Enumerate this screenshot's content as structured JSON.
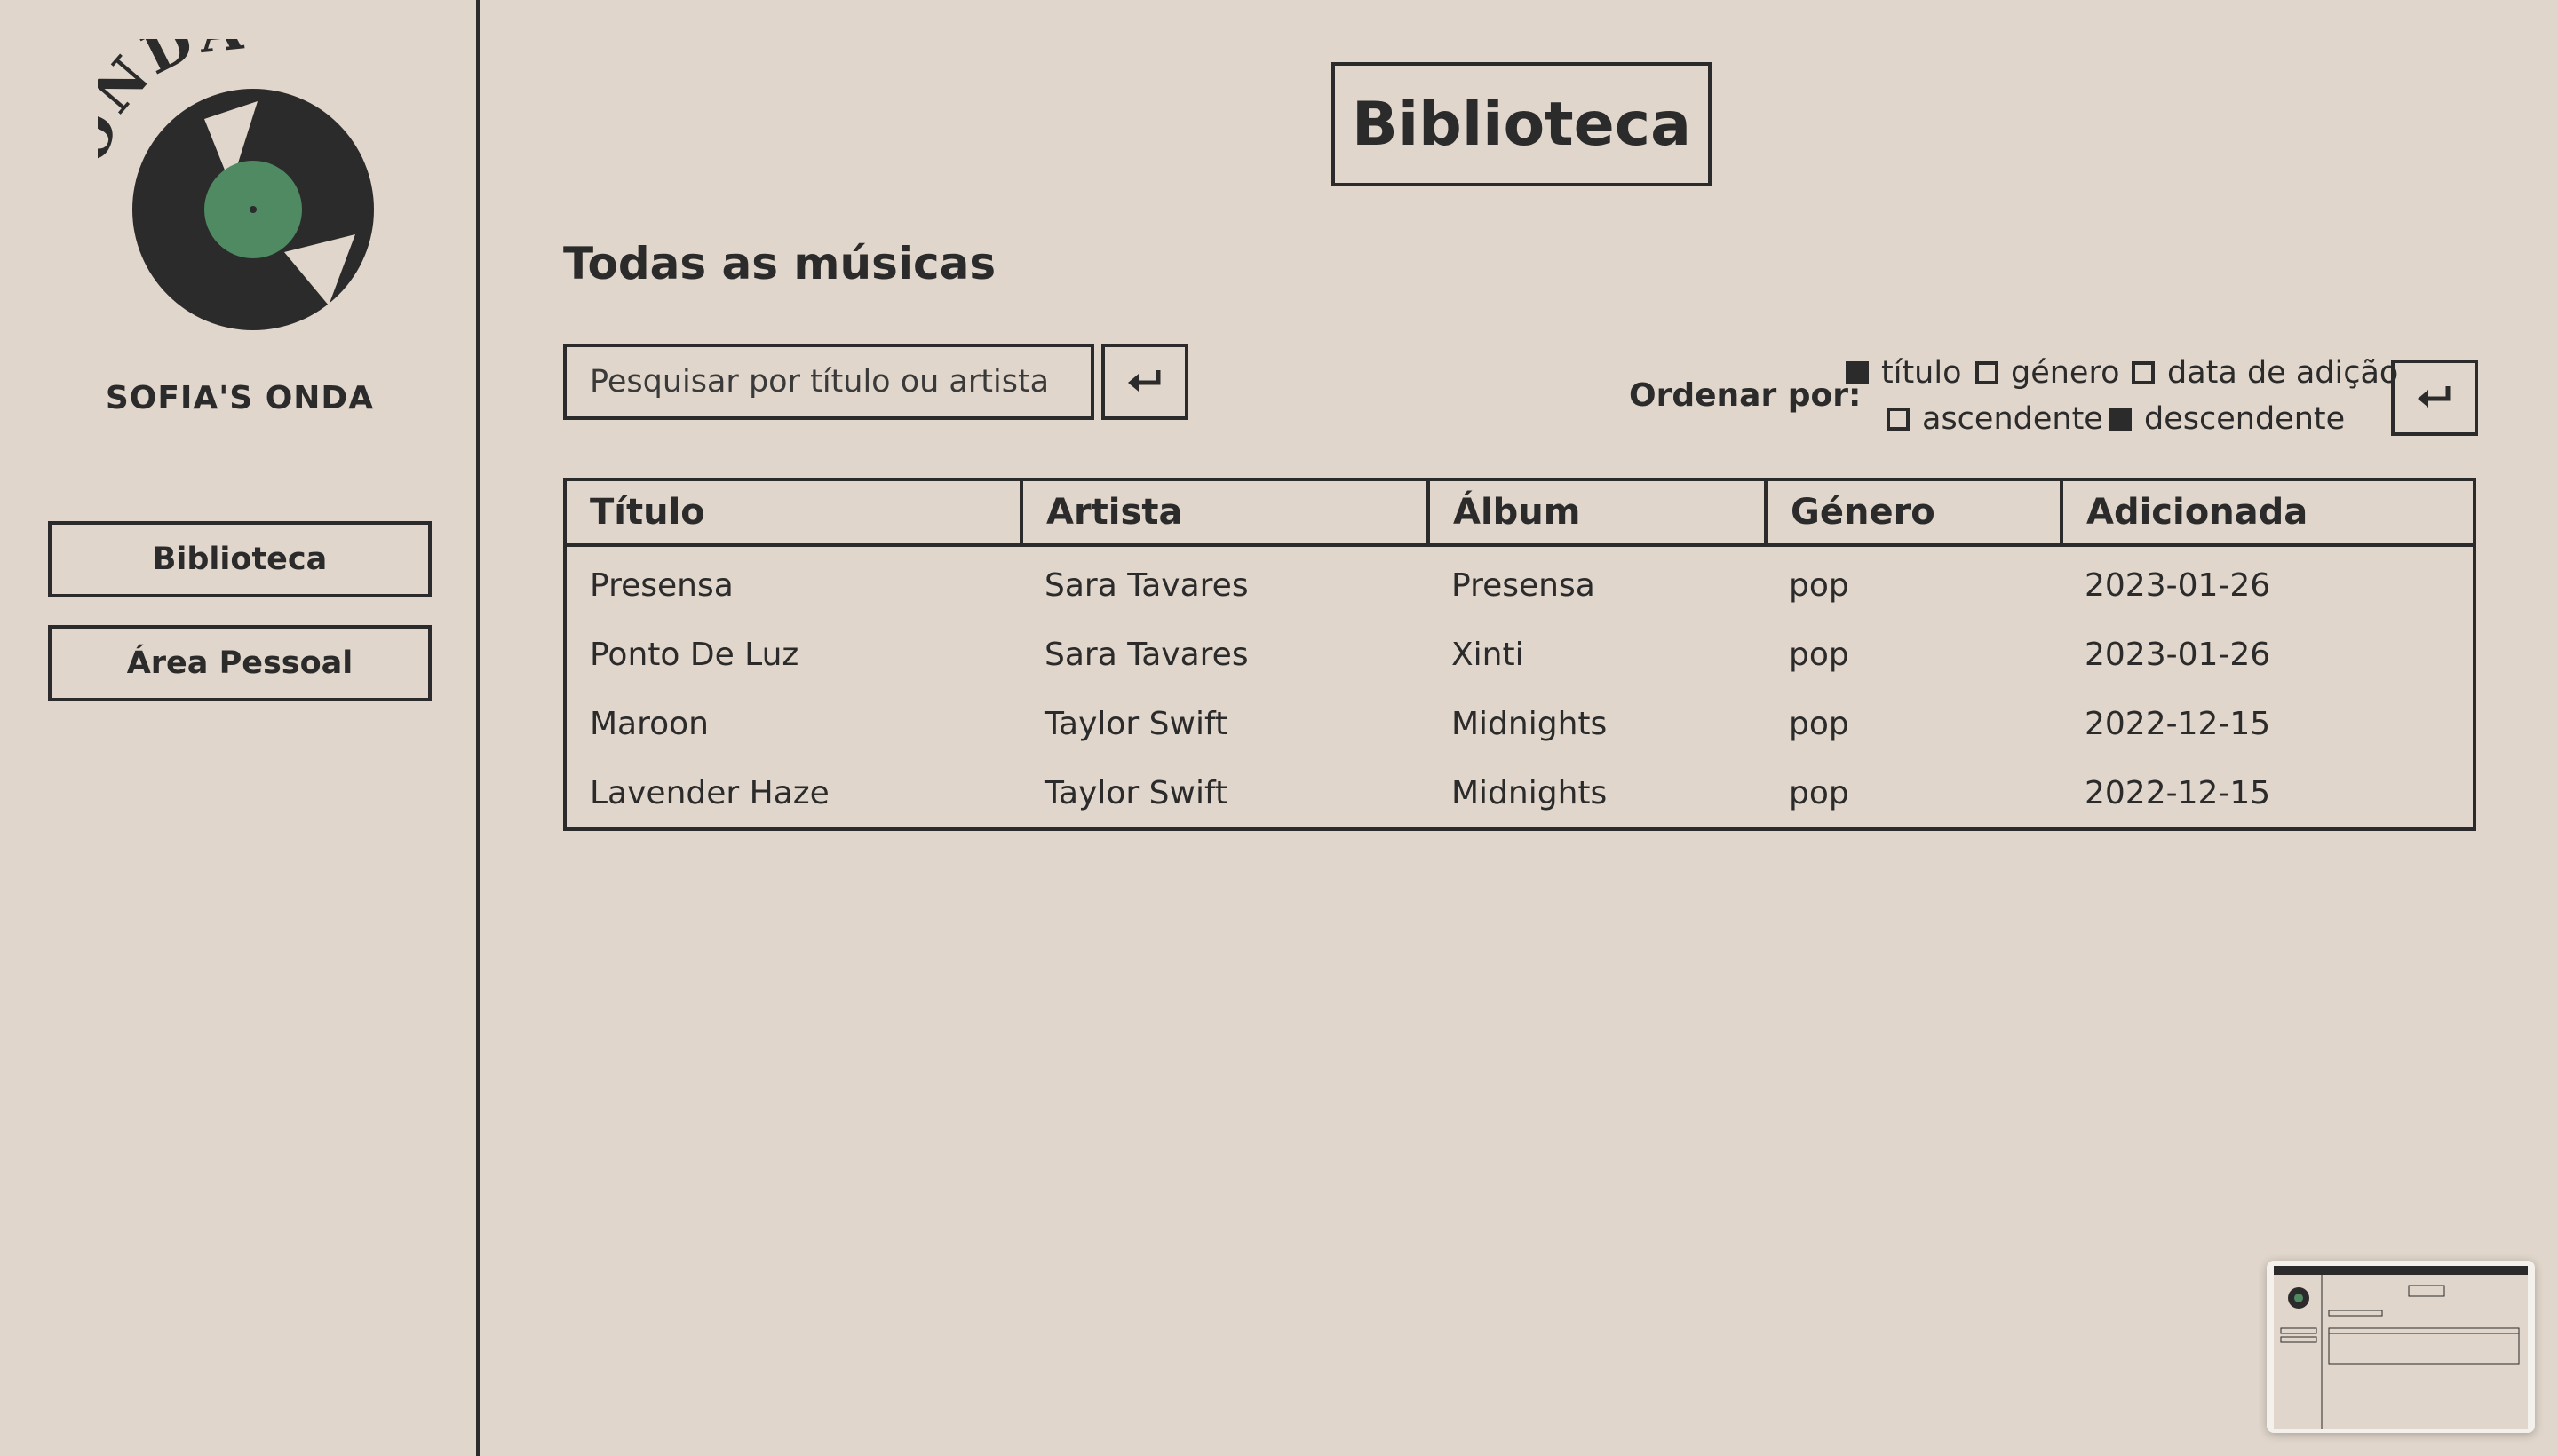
{
  "sidebar": {
    "logo_text": "ONDA",
    "brand": "SOFIA'S ONDA",
    "nav": [
      {
        "label": "Biblioteca"
      },
      {
        "label": "Área Pessoal"
      }
    ]
  },
  "main": {
    "page_title": "Biblioteca",
    "section_title": "Todas as músicas",
    "search": {
      "placeholder": "Pesquisar por título ou artista",
      "value": ""
    },
    "sort": {
      "label": "Ordenar por:",
      "fields": [
        {
          "label": "título",
          "checked": true
        },
        {
          "label": "género",
          "checked": false
        },
        {
          "label": "data de adição",
          "checked": false
        }
      ],
      "order": [
        {
          "label": "ascendente",
          "checked": false
        },
        {
          "label": "descendente",
          "checked": true
        }
      ]
    },
    "table": {
      "columns": [
        "Título",
        "Artista",
        "Álbum",
        "Género",
        "Adicionada"
      ],
      "rows": [
        [
          "Presensa",
          "Sara Tavares",
          "Presensa",
          "pop",
          "2023-01-26"
        ],
        [
          "Ponto De Luz",
          "Sara Tavares",
          "Xinti",
          "pop",
          "2023-01-26"
        ],
        [
          "Maroon",
          "Taylor Swift",
          "Midnights",
          "pop",
          "2022-12-15"
        ],
        [
          "Lavender Haze",
          "Taylor Swift",
          "Midnights",
          "pop",
          "2022-12-15"
        ]
      ]
    }
  },
  "colors": {
    "background": "#e0d6cb",
    "ink": "#2b2b2b",
    "label_green": "#4f8a62"
  },
  "icons": [
    "vinyl-record-logo",
    "enter-icon"
  ]
}
